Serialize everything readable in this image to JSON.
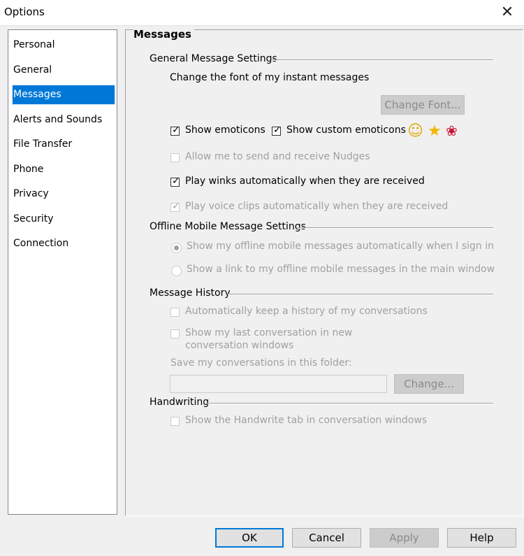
{
  "window": {
    "title": "Options",
    "close_glyph": "✕"
  },
  "nav": {
    "items": [
      {
        "label": "Personal",
        "selected": false
      },
      {
        "label": "General",
        "selected": false
      },
      {
        "label": "Messages",
        "selected": true
      },
      {
        "label": "Alerts and Sounds",
        "selected": false
      },
      {
        "label": "File Transfer",
        "selected": false
      },
      {
        "label": "Phone",
        "selected": false
      },
      {
        "label": "Privacy",
        "selected": false
      },
      {
        "label": "Security",
        "selected": false
      },
      {
        "label": "Connection",
        "selected": false
      }
    ]
  },
  "panel": {
    "title": "Messages",
    "general": {
      "heading": "General Message Settings",
      "font_text": "Change the font of my instant messages",
      "change_font_button": "Change Font...",
      "show_emoticons": {
        "label": "Show emoticons",
        "checked": true,
        "enabled": true
      },
      "show_custom_emoticons": {
        "label": "Show custom emoticons",
        "checked": true,
        "enabled": true
      },
      "emoticon_icons": [
        "smiley-icon",
        "star-icon",
        "rose-icon"
      ],
      "emoticon_glyphs": [
        "☺",
        "★",
        "❀"
      ],
      "nudges": {
        "label": "Allow me to send and receive Nudges",
        "checked": false,
        "enabled": false
      },
      "winks": {
        "label": "Play winks automatically when they are received",
        "checked": true,
        "enabled": true
      },
      "voice_clips": {
        "label": "Play voice clips automatically when they are received",
        "checked": true,
        "enabled": false
      }
    },
    "offline": {
      "heading": "Offline Mobile Message Settings",
      "option_auto": {
        "label": "Show my offline mobile messages automatically when I sign in",
        "selected": true,
        "enabled": false
      },
      "option_link": {
        "label": "Show a link to my offline mobile messages in the main window",
        "selected": false,
        "enabled": false
      }
    },
    "history": {
      "heading": "Message History",
      "keep_history": {
        "label": "Automatically keep a history of my conversations",
        "checked": false,
        "enabled": false
      },
      "show_last_line1": "Show my last conversation in new",
      "show_last_line2": "conversation windows",
      "show_last_checked": false,
      "folder_label": "Save my conversations in this folder:",
      "folder_value": "",
      "change_button": "Change..."
    },
    "handwriting": {
      "heading": "Handwriting",
      "handwrite_tab": {
        "label": "Show the Handwrite tab in conversation windows",
        "checked": false,
        "enabled": false
      }
    }
  },
  "footer": {
    "ok": "OK",
    "cancel": "Cancel",
    "apply": "Apply",
    "help": "Help"
  },
  "colors": {
    "selection": "#0078d7",
    "disabled_text": "#a0a0a0",
    "dialog_bg": "#f0f0f0"
  }
}
